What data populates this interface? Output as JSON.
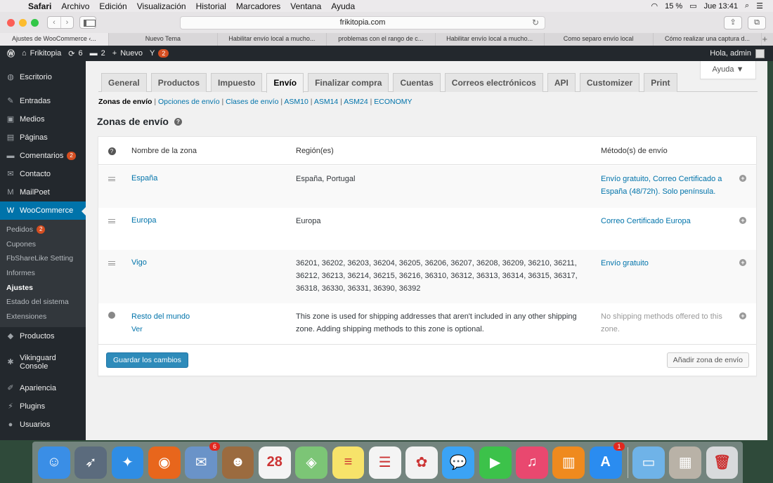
{
  "menubar": {
    "apple": "",
    "items": [
      "Safari",
      "Archivo",
      "Edición",
      "Visualización",
      "Historial",
      "Marcadores",
      "Ventana",
      "Ayuda"
    ],
    "battery": "15 %",
    "clock": "Jue 13:41"
  },
  "browser": {
    "url": "frikitopia.com",
    "tabs": [
      "Ajustes de WooCommerce ‹...",
      "Nuevo Tema",
      "Habilitar envío local a mucho...",
      "problemas con el rango de c...",
      "Habilitar envío local a mucho...",
      "Como separo envío local",
      "Cómo realizar una captura d..."
    ],
    "new_tab": "+"
  },
  "adminbar": {
    "site": "Frikitopia",
    "updates": "6",
    "comments": "2",
    "new": "Nuevo",
    "plugin_badge": "2",
    "greeting": "Hola, admin"
  },
  "sidebar": {
    "items": [
      {
        "label": "Escritorio",
        "icon": "dashboard-icon",
        "glyph": "◍"
      },
      {
        "label": "Entradas",
        "icon": "pin-icon",
        "glyph": "✎"
      },
      {
        "label": "Medios",
        "icon": "media-icon",
        "glyph": "▣"
      },
      {
        "label": "Páginas",
        "icon": "pages-icon",
        "glyph": "▤"
      },
      {
        "label": "Comentarios",
        "icon": "comments-icon",
        "glyph": "▬",
        "badge": "2"
      },
      {
        "label": "Contacto",
        "icon": "mail-icon",
        "glyph": "✉"
      },
      {
        "label": "MailPoet",
        "icon": "mailpoet-icon",
        "glyph": "M"
      },
      {
        "label": "WooCommerce",
        "icon": "woo-icon",
        "glyph": "W"
      }
    ],
    "submenu": [
      {
        "label": "Pedidos",
        "badge": "2"
      },
      {
        "label": "Cupones"
      },
      {
        "label": "FbShareLike Setting"
      },
      {
        "label": "Informes"
      },
      {
        "label": "Ajustes"
      },
      {
        "label": "Estado del sistema"
      },
      {
        "label": "Extensiones"
      }
    ],
    "bottom_items": [
      {
        "label": "Productos",
        "icon": "products-icon",
        "glyph": "◆"
      },
      {
        "label": "Vikinguard Console",
        "icon": "gear-icon",
        "glyph": "✱"
      },
      {
        "label": "Apariencia",
        "icon": "brush-icon",
        "glyph": "✐"
      },
      {
        "label": "Plugins",
        "icon": "plugin-icon",
        "glyph": "⚡"
      },
      {
        "label": "Usuarios",
        "icon": "users-icon",
        "glyph": "●"
      }
    ]
  },
  "help_label": "Ayuda ▼",
  "tabs": [
    "General",
    "Productos",
    "Impuesto",
    "Envío",
    "Finalizar compra",
    "Cuentas",
    "Correos electrónicos",
    "API",
    "Customizer",
    "Print"
  ],
  "active_tab": "Envío",
  "subsub": {
    "current": "Zonas de envío",
    "links": [
      "Opciones de envío",
      "Clases de envío",
      "ASM10",
      "ASM14",
      "ASM24",
      "ECONOMY"
    ]
  },
  "page_title": "Zonas de envío",
  "table": {
    "headers": {
      "name": "Nombre de la zona",
      "region": "Región(es)",
      "methods": "Método(s) de envío"
    },
    "rows": [
      {
        "name": "España",
        "region": "España, Portugal",
        "methods": "Envío gratuito, Correo Certificado a España (48/72h). Solo península."
      },
      {
        "name": "Europa",
        "region": "Europa",
        "methods": "Correo Certificado Europa"
      },
      {
        "name": "Vigo",
        "region": "36201, 36202, 36203, 36204, 36205, 36206, 36207, 36208, 36209, 36210, 36211, 36212, 36213, 36214, 36215, 36216, 36310, 36312, 36313, 36314, 36315, 36317, 36318, 36330, 36331, 36390, 36392",
        "methods": "Envío gratuito"
      }
    ],
    "rest": {
      "name": "Resto del mundo",
      "view": "Ver",
      "region": "This zone is used for shipping addresses that aren't included in any other shipping zone. Adding shipping methods to this zone is optional.",
      "methods": "No shipping methods offered to this zone."
    }
  },
  "buttons": {
    "save": "Guardar los cambios",
    "add_zone": "Añadir zona de envío"
  },
  "dock": {
    "apps": [
      {
        "name": "finder-icon",
        "color": "#3a8ee6",
        "glyph": "☺"
      },
      {
        "name": "launchpad-icon",
        "color": "#5b6b7d",
        "glyph": "➶"
      },
      {
        "name": "safari-icon",
        "color": "#2f8de4",
        "glyph": "✦"
      },
      {
        "name": "firefox-icon",
        "color": "#e8661c",
        "glyph": "◉"
      },
      {
        "name": "mail-stamp-icon",
        "color": "#6a93c8",
        "glyph": "✉",
        "badge": "6"
      },
      {
        "name": "contacts-icon",
        "color": "#9b6b3f",
        "glyph": "☻"
      },
      {
        "name": "calendar-icon",
        "color": "#f4f4f4",
        "glyph": "28",
        "dark": true
      },
      {
        "name": "maps-icon",
        "color": "#7cc576",
        "glyph": "◈"
      },
      {
        "name": "notes-icon",
        "color": "#f7e36a",
        "glyph": "≡",
        "dark": true
      },
      {
        "name": "reminders-icon",
        "color": "#f4f4f4",
        "glyph": "☰",
        "dark": true
      },
      {
        "name": "photos-icon",
        "color": "#f2f2f2",
        "glyph": "✿",
        "dark": true
      },
      {
        "name": "messages-icon",
        "color": "#3ba3f5",
        "glyph": "💬"
      },
      {
        "name": "facetime-icon",
        "color": "#3cc24a",
        "glyph": "▶"
      },
      {
        "name": "itunes-icon",
        "color": "#e9486f",
        "glyph": "♫"
      },
      {
        "name": "ibooks-icon",
        "color": "#ef8a1e",
        "glyph": "▥"
      },
      {
        "name": "appstore-icon",
        "color": "#2a8cf0",
        "glyph": "A",
        "badge": "1"
      }
    ],
    "right": [
      {
        "name": "folder-icon",
        "color": "#6fb3e8",
        "glyph": "▭"
      },
      {
        "name": "downloads-icon",
        "color": "#b9b2a7",
        "glyph": "▦"
      },
      {
        "name": "trash-icon",
        "color": "#d8dadc",
        "glyph": "🗑",
        "dark": true
      }
    ]
  }
}
